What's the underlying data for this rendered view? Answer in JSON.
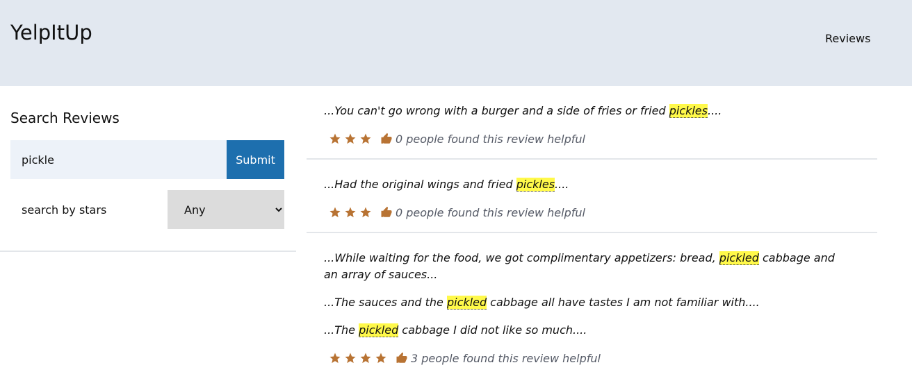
{
  "header": {
    "brand": "YelpItUp",
    "nav_reviews": "Reviews"
  },
  "sidebar": {
    "title": "Search Reviews",
    "search_value": "pickle",
    "submit_label": "Submit",
    "stars_label": "search by stars",
    "stars_selected": "Any"
  },
  "reviews": [
    {
      "snippets": [
        {
          "before": "...You can't go wrong with a burger and a side of fries or fried ",
          "highlight": "pickles",
          "after": "...."
        }
      ],
      "stars": 3,
      "helpful_text": "0 people found this review helpful"
    },
    {
      "snippets": [
        {
          "before": "...Had the original wings and fried ",
          "highlight": "pickles",
          "after": "...."
        }
      ],
      "stars": 3,
      "helpful_text": "0 people found this review helpful"
    },
    {
      "snippets": [
        {
          "before": "...While waiting for the food, we got complimentary appetizers: bread, ",
          "highlight": "pickled",
          "after": " cabbage and an array of sauces..."
        },
        {
          "before": "...The sauces and the ",
          "highlight": "pickled",
          "after": " cabbage all have tastes I am not familiar with...."
        },
        {
          "before": "...The ",
          "highlight": "pickled",
          "after": " cabbage I did not like so much...."
        }
      ],
      "stars": 4,
      "helpful_text": "3 people found this review helpful"
    }
  ],
  "colors": {
    "header_bg": "#e2e8f0",
    "accent": "#1d6fae",
    "star": "#b87333",
    "highlight": "#fff94a"
  },
  "icons": {
    "star": "star-icon",
    "helpful": "thumbs-up-icon"
  }
}
